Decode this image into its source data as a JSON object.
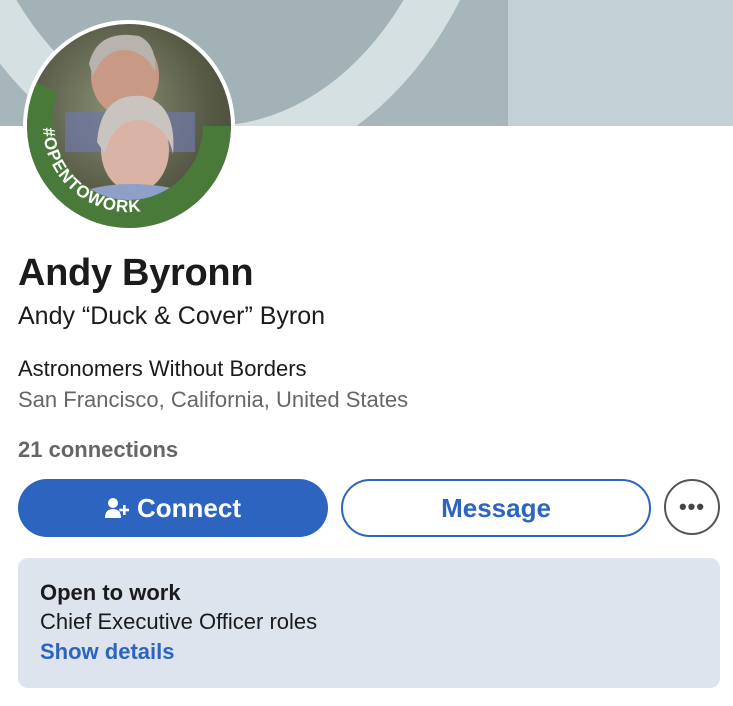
{
  "profile": {
    "name": "Andy Byronn",
    "headline": "Andy “Duck & Cover” Byron",
    "company": "Astronomers Without Borders",
    "location": "San Francisco, California, United States",
    "connections": "21 connections",
    "avatar_badge": "#OPENTOWORK"
  },
  "actions": {
    "connect_label": "Connect",
    "connect_icon": "add-person-icon",
    "message_label": "Message",
    "more_label": "•••",
    "more_icon": "more-options-icon"
  },
  "open_to_work": {
    "title": "Open to work",
    "roles": "Chief Executive Officer roles",
    "link": "Show details"
  },
  "colors": {
    "accent": "#2c64c0",
    "badge_green": "#4a7a3a",
    "card_bg": "#dde4ee"
  }
}
